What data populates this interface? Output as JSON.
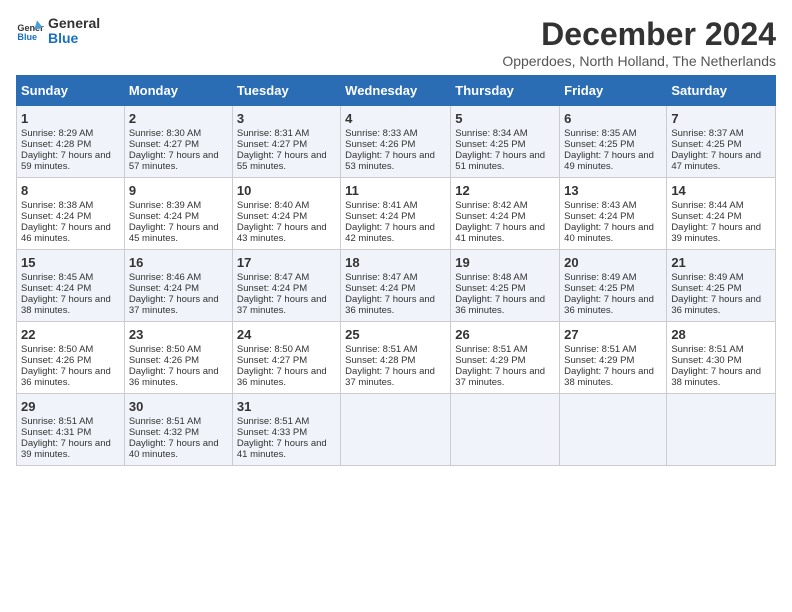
{
  "logo": {
    "line1": "General",
    "line2": "Blue"
  },
  "title": "December 2024",
  "subtitle": "Opperdoes, North Holland, The Netherlands",
  "days_of_week": [
    "Sunday",
    "Monday",
    "Tuesday",
    "Wednesday",
    "Thursday",
    "Friday",
    "Saturday"
  ],
  "weeks": [
    [
      {
        "day": "1",
        "sunrise": "8:29 AM",
        "sunset": "4:28 PM",
        "daylight": "7 hours and 59 minutes."
      },
      {
        "day": "2",
        "sunrise": "8:30 AM",
        "sunset": "4:27 PM",
        "daylight": "7 hours and 57 minutes."
      },
      {
        "day": "3",
        "sunrise": "8:31 AM",
        "sunset": "4:27 PM",
        "daylight": "7 hours and 55 minutes."
      },
      {
        "day": "4",
        "sunrise": "8:33 AM",
        "sunset": "4:26 PM",
        "daylight": "7 hours and 53 minutes."
      },
      {
        "day": "5",
        "sunrise": "8:34 AM",
        "sunset": "4:25 PM",
        "daylight": "7 hours and 51 minutes."
      },
      {
        "day": "6",
        "sunrise": "8:35 AM",
        "sunset": "4:25 PM",
        "daylight": "7 hours and 49 minutes."
      },
      {
        "day": "7",
        "sunrise": "8:37 AM",
        "sunset": "4:25 PM",
        "daylight": "7 hours and 47 minutes."
      }
    ],
    [
      {
        "day": "8",
        "sunrise": "8:38 AM",
        "sunset": "4:24 PM",
        "daylight": "7 hours and 46 minutes."
      },
      {
        "day": "9",
        "sunrise": "8:39 AM",
        "sunset": "4:24 PM",
        "daylight": "7 hours and 45 minutes."
      },
      {
        "day": "10",
        "sunrise": "8:40 AM",
        "sunset": "4:24 PM",
        "daylight": "7 hours and 43 minutes."
      },
      {
        "day": "11",
        "sunrise": "8:41 AM",
        "sunset": "4:24 PM",
        "daylight": "7 hours and 42 minutes."
      },
      {
        "day": "12",
        "sunrise": "8:42 AM",
        "sunset": "4:24 PM",
        "daylight": "7 hours and 41 minutes."
      },
      {
        "day": "13",
        "sunrise": "8:43 AM",
        "sunset": "4:24 PM",
        "daylight": "7 hours and 40 minutes."
      },
      {
        "day": "14",
        "sunrise": "8:44 AM",
        "sunset": "4:24 PM",
        "daylight": "7 hours and 39 minutes."
      }
    ],
    [
      {
        "day": "15",
        "sunrise": "8:45 AM",
        "sunset": "4:24 PM",
        "daylight": "7 hours and 38 minutes."
      },
      {
        "day": "16",
        "sunrise": "8:46 AM",
        "sunset": "4:24 PM",
        "daylight": "7 hours and 37 minutes."
      },
      {
        "day": "17",
        "sunrise": "8:47 AM",
        "sunset": "4:24 PM",
        "daylight": "7 hours and 37 minutes."
      },
      {
        "day": "18",
        "sunrise": "8:47 AM",
        "sunset": "4:24 PM",
        "daylight": "7 hours and 36 minutes."
      },
      {
        "day": "19",
        "sunrise": "8:48 AM",
        "sunset": "4:25 PM",
        "daylight": "7 hours and 36 minutes."
      },
      {
        "day": "20",
        "sunrise": "8:49 AM",
        "sunset": "4:25 PM",
        "daylight": "7 hours and 36 minutes."
      },
      {
        "day": "21",
        "sunrise": "8:49 AM",
        "sunset": "4:25 PM",
        "daylight": "7 hours and 36 minutes."
      }
    ],
    [
      {
        "day": "22",
        "sunrise": "8:50 AM",
        "sunset": "4:26 PM",
        "daylight": "7 hours and 36 minutes."
      },
      {
        "day": "23",
        "sunrise": "8:50 AM",
        "sunset": "4:26 PM",
        "daylight": "7 hours and 36 minutes."
      },
      {
        "day": "24",
        "sunrise": "8:50 AM",
        "sunset": "4:27 PM",
        "daylight": "7 hours and 36 minutes."
      },
      {
        "day": "25",
        "sunrise": "8:51 AM",
        "sunset": "4:28 PM",
        "daylight": "7 hours and 37 minutes."
      },
      {
        "day": "26",
        "sunrise": "8:51 AM",
        "sunset": "4:29 PM",
        "daylight": "7 hours and 37 minutes."
      },
      {
        "day": "27",
        "sunrise": "8:51 AM",
        "sunset": "4:29 PM",
        "daylight": "7 hours and 38 minutes."
      },
      {
        "day": "28",
        "sunrise": "8:51 AM",
        "sunset": "4:30 PM",
        "daylight": "7 hours and 38 minutes."
      }
    ],
    [
      {
        "day": "29",
        "sunrise": "8:51 AM",
        "sunset": "4:31 PM",
        "daylight": "7 hours and 39 minutes."
      },
      {
        "day": "30",
        "sunrise": "8:51 AM",
        "sunset": "4:32 PM",
        "daylight": "7 hours and 40 minutes."
      },
      {
        "day": "31",
        "sunrise": "8:51 AM",
        "sunset": "4:33 PM",
        "daylight": "7 hours and 41 minutes."
      },
      null,
      null,
      null,
      null
    ]
  ],
  "labels": {
    "sunrise": "Sunrise:",
    "sunset": "Sunset:",
    "daylight": "Daylight:"
  }
}
